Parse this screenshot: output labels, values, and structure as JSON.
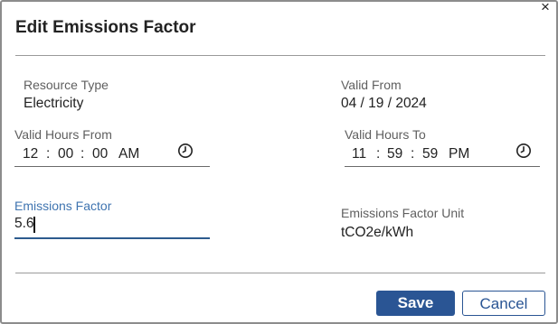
{
  "dialog": {
    "title": "Edit Emissions Factor",
    "close_glyph": "×"
  },
  "resource_type": {
    "label": "Resource Type",
    "value": "Electricity"
  },
  "valid_from": {
    "label": "Valid From",
    "value": "04 / 19 / 2024"
  },
  "valid_hours_from": {
    "label": "Valid Hours From",
    "hour": "12",
    "minute": "00",
    "second": "00",
    "ampm": "AM",
    "sep": ":"
  },
  "valid_hours_to": {
    "label": "Valid Hours To",
    "hour": "11",
    "minute": "59",
    "second": "59",
    "ampm": "PM",
    "sep": ":"
  },
  "emissions_factor": {
    "label": "Emissions Factor",
    "value": "5.6"
  },
  "emissions_factor_unit": {
    "label": "Emissions Factor Unit",
    "value": "tCO2e/kWh"
  },
  "buttons": {
    "save": "Save",
    "cancel": "Cancel"
  },
  "colors": {
    "accent": "#2a5594",
    "focus_label": "#3f74b0"
  },
  "icons": {
    "close": "close-icon",
    "clock": "clock-icon"
  }
}
